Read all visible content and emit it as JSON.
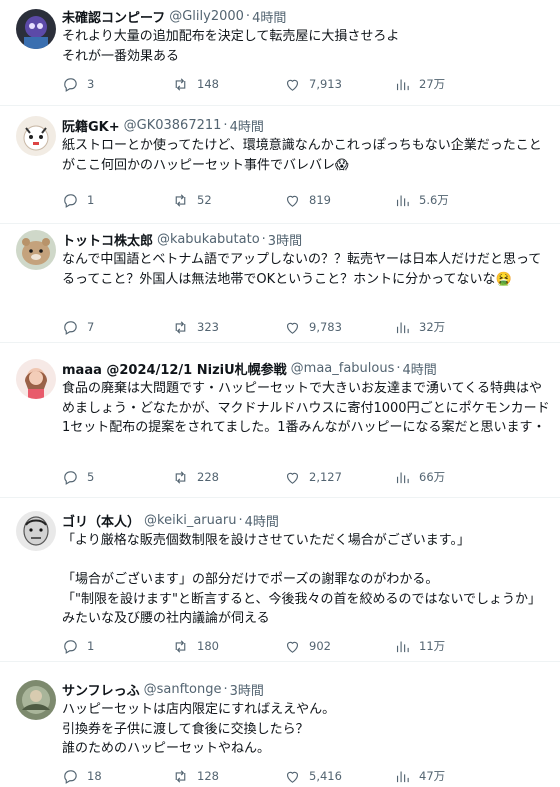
{
  "tweets": [
    {
      "name": "未確認コンピーフ",
      "handle": "@Glily2000",
      "time": "4時間",
      "text": "それより大量の追加配布を決定して転売屋に大損させろよ\nそれが一番効果ある",
      "replies": "3",
      "retweets": "148",
      "likes": "7,913",
      "views": "27万"
    },
    {
      "name": "阮籍GK+",
      "handle": "@GK03867211",
      "time": "4時間",
      "text": "紙ストローとか使ってたけど、環境意識なんかこれっぽっちもない企業だったことがここ何回かのハッピーセット事件でバレバレ",
      "emoji": "😱",
      "replies": "1",
      "retweets": "52",
      "likes": "819",
      "views": "5.6万"
    },
    {
      "name": "トットコ株太郎",
      "handle": "@kabukabutato",
      "time": "3時間",
      "text": "なんで中国語とベトナム語でアップしないの？？転売ヤーは日本人だけだと思ってるってこと？外国人は無法地帯でOKということ？ホントに分かってないな",
      "emoji": "🤮",
      "replies": "7",
      "retweets": "323",
      "likes": "9,783",
      "views": "32万"
    },
    {
      "name": "maaa @2024/12/1 NiziU札幌参戦",
      "handle": "@maa_fabulous",
      "time": "4時間",
      "text": "食品の廃棄は大問題です・ハッピーセットで大きいお友達まで湧いてくる特典はやめましょう・どなたかが、マクドナルドハウスに寄付1000円ごとにポケモンカード1セット配布の提案をされてました。1番みんながハッピーになる案だと思います・",
      "replies": "5",
      "retweets": "228",
      "likes": "2,127",
      "views": "66万"
    },
    {
      "name": "ゴリ（本人）",
      "handle": "@keiki_aruaru",
      "time": "4時間",
      "text": "「より厳格な販売個数制限を設けさせていただく場合がございます。」\n\n「場合がございます」の部分だけでポーズの謝罪なのがわかる。\n「\"制限を設けます\"と断言すると、今後我々の首を絞めるのではないでしょうか」みたいな及び腰の社内議論が伺える",
      "replies": "1",
      "retweets": "180",
      "likes": "902",
      "views": "11万"
    },
    {
      "name": "サンフレっふ",
      "handle": "@sanftonge",
      "time": "3時間",
      "text": "ハッピーセットは店内限定にすればええやん。\n引換券を子供に渡して食後に交換したら？\n誰のためのハッピーセットやねん。",
      "replies": "18",
      "retweets": "128",
      "likes": "5,416",
      "views": "47万"
    }
  ],
  "colors": {
    "text": "#0f1419",
    "secondary": "#536471",
    "divider": "#eff3f4"
  },
  "icons": [
    "reply-icon",
    "retweet-icon",
    "like-icon",
    "views-icon"
  ]
}
